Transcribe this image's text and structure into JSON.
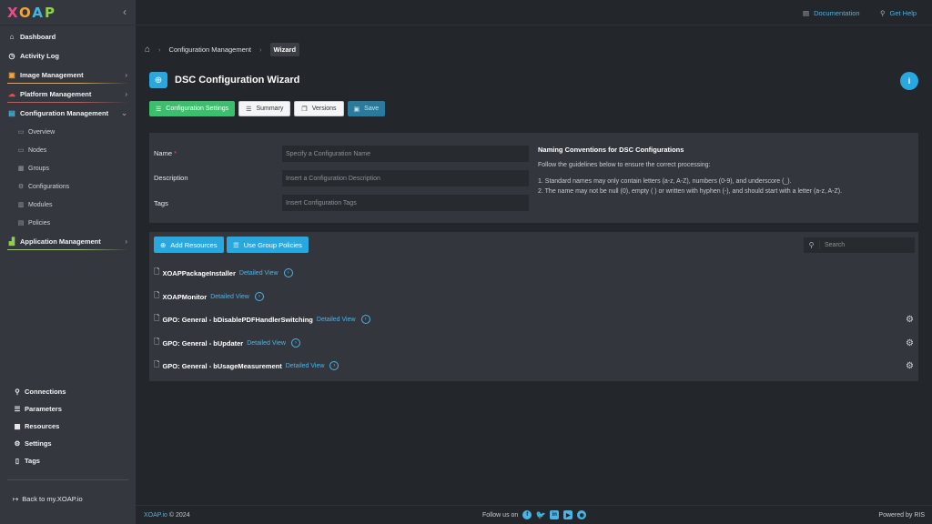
{
  "app": {
    "logo": [
      "X",
      "O",
      "A",
      "P"
    ]
  },
  "sidebar": {
    "items": [
      {
        "label": "Dashboard",
        "icon": "home-icon"
      },
      {
        "label": "Activity Log",
        "icon": "clock-icon"
      },
      {
        "label": "Image Management",
        "icon": "image-icon",
        "accent": "#f2a33a"
      },
      {
        "label": "Platform Management",
        "icon": "cloud-icon",
        "accent": "#e94b4b"
      },
      {
        "label": "Configuration Management",
        "icon": "config-icon",
        "accent": "#40b6e4"
      },
      {
        "label": "Application Management",
        "icon": "chart-icon",
        "accent": "#8fd14f"
      }
    ],
    "sub_items": [
      "Overview",
      "Nodes",
      "Groups",
      "Configurations",
      "Modules",
      "Policies"
    ],
    "bottom_items": [
      "Connections",
      "Parameters",
      "Resources",
      "Settings",
      "Tags"
    ],
    "back_link": "Back to my.XOAP.io"
  },
  "topbar": {
    "documentation": "Documentation",
    "get_help": "Get Help"
  },
  "breadcrumb": {
    "item1": "Configuration Management",
    "current": "Wizard"
  },
  "page": {
    "title": "DSC Configuration Wizard"
  },
  "actions": {
    "config_settings": "Configuration Settings",
    "summary": "Summary",
    "versions": "Versions",
    "save": "Save"
  },
  "form": {
    "name_label": "Name",
    "required_mark": "*",
    "name_placeholder": "Specify a Configuration Name",
    "description_label": "Description",
    "description_placeholder": "Insert a Configuration Description",
    "tags_label": "Tags",
    "tags_placeholder": "Insert Configuration Tags"
  },
  "naming": {
    "title": "Naming Conventions for DSC Configurations",
    "intro": "Follow the guidelines below to ensure the correct processing:",
    "rule1": "1. Standard names may only contain letters (a-z, A-Z), numbers (0-9), and underscore (_).",
    "rule2": "2. The name may not be null (0), empty ( ) or written with hyphen (-), and should start with a letter (a-z, A-Z)."
  },
  "resources": {
    "add_label": "Add Resources",
    "group_label": "Use Group Policies",
    "search_placeholder": "Search",
    "detail_label": "Detailed View",
    "rows": [
      {
        "name": "XOAPPackageInstaller",
        "gear": false
      },
      {
        "name": "XOAPMonitor",
        "gear": false
      },
      {
        "name": "GPO: General - bDisablePDFHandlerSwitching",
        "gear": true
      },
      {
        "name": "GPO: General - bUpdater",
        "gear": true
      },
      {
        "name": "GPO: General - bUsageMeasurement",
        "gear": true
      }
    ]
  },
  "footer": {
    "brand": "XOAP.io",
    "copyright": "© 2024",
    "follow": "Follow us on",
    "powered": "Powered by RIS"
  },
  "colors": {
    "accent_blue": "#29a7df",
    "success_green": "#3cbf6c"
  }
}
